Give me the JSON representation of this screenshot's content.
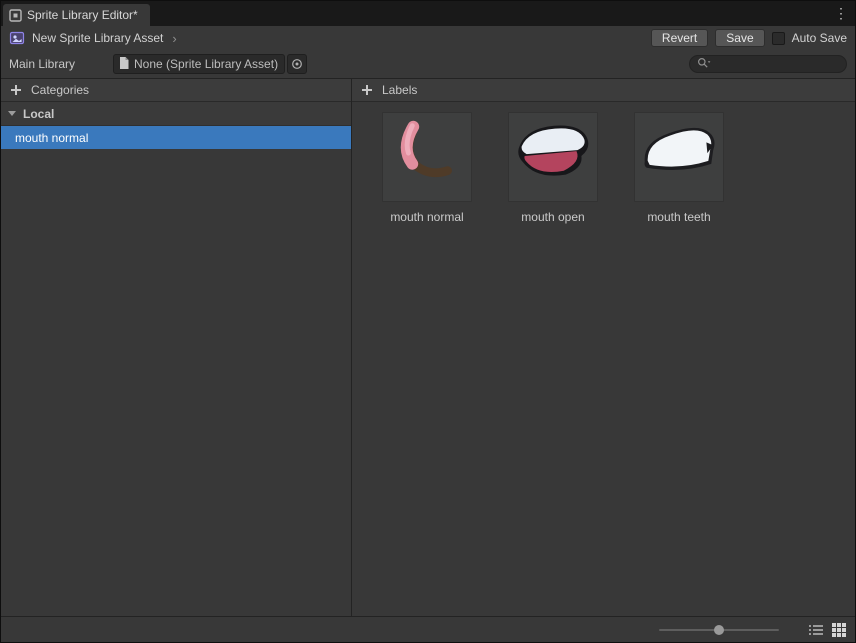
{
  "window": {
    "tab_title": "Sprite Library Editor*"
  },
  "toolbar": {
    "asset_name": "New Sprite Library Asset",
    "revert_label": "Revert",
    "save_label": "Save",
    "auto_save_label": "Auto Save",
    "auto_save_checked": false
  },
  "main_library": {
    "label": "Main Library",
    "object_value": "None (Sprite Library Asset)",
    "search_placeholder": ""
  },
  "categories_panel": {
    "header": "Categories",
    "groups": [
      {
        "name": "Local",
        "items": [
          {
            "name": "mouth normal",
            "selected": true
          }
        ]
      }
    ]
  },
  "labels_panel": {
    "header": "Labels",
    "items": [
      {
        "name": "mouth normal"
      },
      {
        "name": "mouth open"
      },
      {
        "name": "mouth teeth"
      }
    ]
  },
  "bottom_bar": {
    "zoom_value": 0.5
  },
  "colors": {
    "selection_blue": "#3a79bd",
    "sprite_pink": "#e28e9e",
    "sprite_crimson": "#b4445e",
    "sprite_white": "#eef2f6",
    "sprite_outline_dark": "#1a1a1d"
  }
}
